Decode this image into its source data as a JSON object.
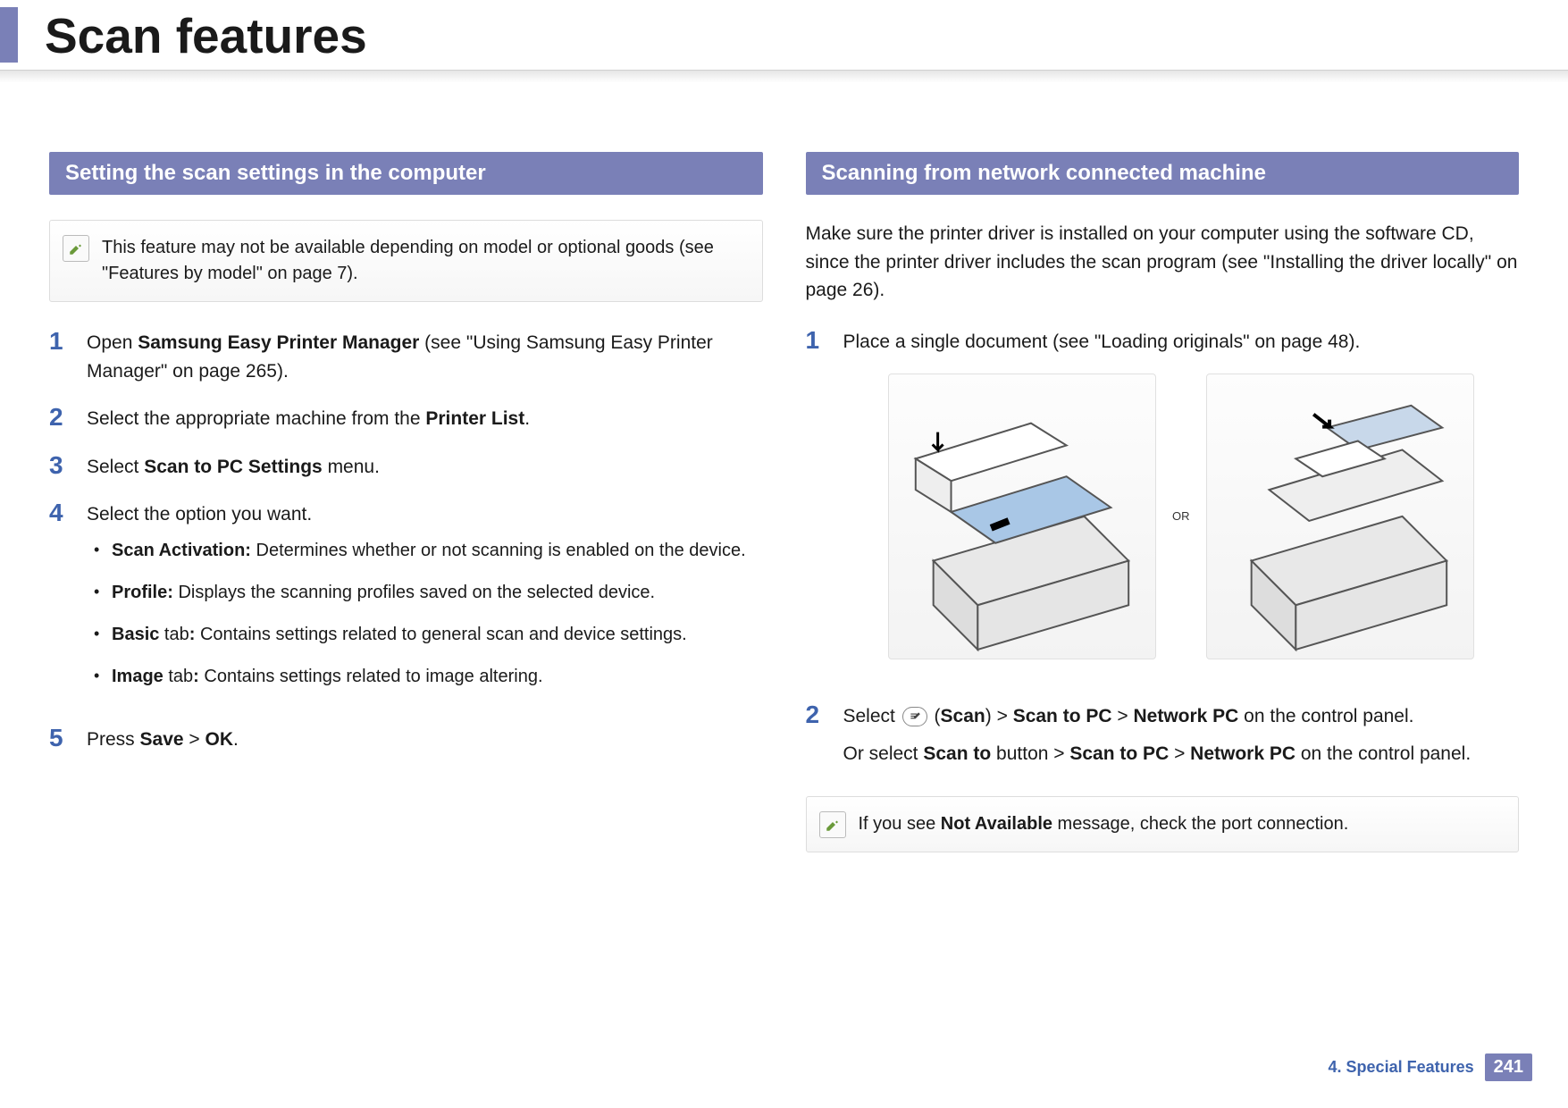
{
  "page_title": "Scan features",
  "left": {
    "section_title": "Setting the scan settings in the computer",
    "note": "This feature may not be available depending on model or optional goods (see \"Features by model\" on page 7).",
    "steps": {
      "s1": {
        "num": "1",
        "prefix": "Open ",
        "bold1": "Samsung Easy Printer Manager",
        "suffix": " (see \"Using Samsung Easy Printer Manager\" on page 265)."
      },
      "s2": {
        "num": "2",
        "prefix": "Select the appropriate machine from the ",
        "bold1": "Printer List",
        "suffix": "."
      },
      "s3": {
        "num": "3",
        "prefix": "Select ",
        "bold1": "Scan to PC Settings",
        "suffix": " menu."
      },
      "s4": {
        "num": "4",
        "text": "Select the option you want.",
        "bullets": {
          "b1": {
            "bold": "Scan Activation:",
            "rest": " Determines whether or not scanning is enabled on the device."
          },
          "b2": {
            "bold": "Profile:",
            "rest": " Displays the scanning profiles saved on the selected device."
          },
          "b3": {
            "bold_a": "Basic",
            "mid": " tab",
            "bold_b": ":",
            "rest": "  Contains settings related to general scan and device settings."
          },
          "b4": {
            "bold_a": "Image",
            "mid": " tab",
            "bold_b": ":",
            "rest": "  Contains settings related to image altering."
          }
        }
      },
      "s5": {
        "num": "5",
        "prefix": "Press ",
        "bold1": "Save",
        "sep": " > ",
        "bold2": "OK",
        "suffix": "."
      }
    }
  },
  "right": {
    "section_title": "Scanning from network connected machine",
    "intro": "Make sure the printer driver is installed on your computer using the software CD, since the printer driver includes the scan program (see \"Installing the driver locally\" on page 26).",
    "steps": {
      "s1": {
        "num": "1",
        "text": "Place a single document (see \"Loading originals\" on page 48)."
      },
      "or_label": "OR",
      "s2": {
        "num": "2",
        "line1": {
          "a": "Select ",
          "b": "(",
          "c": "Scan",
          "d": ") > ",
          "e": "Scan to PC",
          "f": " > ",
          "g": "Network PC",
          "h": " on the control panel."
        },
        "line2": {
          "a": "Or select ",
          "b": "Scan to",
          "c": " button > ",
          "d": "Scan to PC",
          "e": " > ",
          "f": "Network PC",
          "g": " on the control panel."
        }
      }
    },
    "note": {
      "a": "If you see ",
      "b": "Not Available",
      "c": " message, check the port connection."
    }
  },
  "footer": {
    "chapter": "4.  Special Features",
    "page": "241"
  }
}
